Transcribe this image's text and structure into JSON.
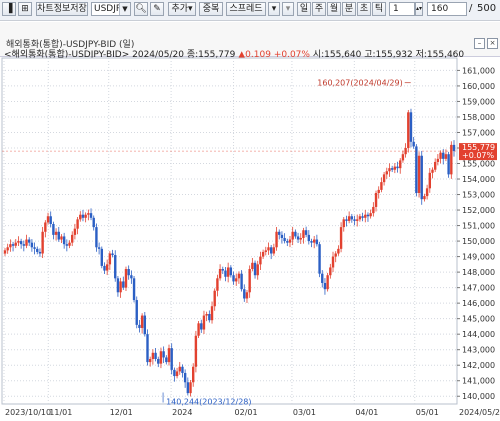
{
  "toolbar": {
    "items": [
      {
        "name": "chart-icon",
        "glyph": "▐"
      },
      {
        "name": "grid-icon",
        "glyph": "⊞"
      }
    ],
    "save_label": "차트정보저장",
    "symbol_value": "USDJPY",
    "add_label": "추가",
    "overlap_label": "중복",
    "spread_label": "스프레드",
    "periods": [
      "일",
      "주",
      "월",
      "분",
      "초",
      "틱"
    ],
    "interval_value": "1",
    "count_value": "160",
    "total_value": "500"
  },
  "header": {
    "window_title": "해외통화(통합)-USDJPY-BID (일)",
    "info_prefix": "<해외통화(통합)-USDJPY-BID> 2024/05/20 종:155,779",
    "info_change": "▲0.109 +0.07%",
    "info_suffix": "시:155,640 고:155,932 저:155,460"
  },
  "chart_data": {
    "type": "candlestick",
    "symbol": "USDJPY-BID",
    "period": "일",
    "date_range": [
      "2023-10-10",
      "2024-05-20"
    ],
    "ylim": [
      139.5,
      161.8
    ],
    "yticks": [
      140,
      141,
      142,
      143,
      144,
      145,
      146,
      147,
      148,
      149,
      150,
      151,
      152,
      153,
      154,
      155,
      156,
      157,
      158,
      159,
      160,
      161
    ],
    "ytick_labels": [
      "140,000",
      "141,000",
      "142,000",
      "143,000",
      "144,000",
      "145,000",
      "146,000",
      "147,000",
      "148,000",
      "149,000",
      "150,000",
      "151,000",
      "152,000",
      "153,000",
      "154,000",
      "155,000",
      "156,000",
      "157,000",
      "158,000",
      "159,000",
      "160,000",
      "161,000"
    ],
    "xtick_labels": [
      "2023/10/10",
      "11/01",
      "12/01",
      "2024",
      "02/01",
      "03/01",
      "04/01",
      "05/01",
      "2024/05/20"
    ],
    "last_price": "155,779",
    "last_change": "+0.07%",
    "annotations": [
      {
        "text": "160,207(2024/04/29)",
        "x": "2024-04-29",
        "y": 160.207
      },
      {
        "text": "140,244(2023/12/28)",
        "x": "2023-12-28",
        "y": 140.244
      }
    ],
    "closes": [
      149.4,
      149.6,
      149.8,
      149.7,
      149.9,
      150.0,
      149.8,
      149.7,
      150.1,
      149.9,
      149.6,
      149.5,
      149.3,
      149.2,
      150.6,
      151.2,
      151.6,
      151.1,
      150.4,
      150.6,
      150.1,
      150.3,
      149.8,
      149.7,
      149.9,
      150.4,
      150.8,
      151.4,
      151.7,
      151.5,
      151.7,
      151.8,
      151.5,
      150.9,
      149.6,
      149.5,
      148.4,
      148.1,
      148.5,
      149.2,
      149.1,
      147.6,
      146.7,
      147.4,
      147.0,
      148.2,
      147.8,
      147.6,
      146.2,
      144.6,
      144.4,
      145.2,
      144.0,
      142.2,
      142.4,
      142.8,
      142.4,
      142.1,
      142.9,
      142.5,
      142.2,
      143.1,
      141.7,
      141.3,
      141.6,
      141.9,
      141.5,
      140.9,
      140.2,
      140.9,
      141.9,
      143.9,
      144.7,
      144.3,
      145.2,
      145.3,
      144.9,
      145.8,
      146.8,
      147.6,
      148.2,
      148.1,
      147.7,
      148.3,
      147.8,
      147.4,
      147.6,
      147.9,
      146.9,
      146.3,
      146.7,
      148.2,
      148.6,
      147.8,
      148.5,
      149.0,
      149.3,
      149.4,
      149.6,
      149.2,
      149.6,
      150.6,
      150.4,
      150.2,
      150.0,
      149.9,
      150.1,
      150.6,
      150.3,
      150.1,
      150.2,
      150.7,
      150.4,
      150.0,
      149.9,
      150.1,
      149.8,
      147.9,
      147.3,
      146.9,
      147.8,
      148.3,
      149.0,
      149.2,
      149.5,
      150.9,
      151.4,
      151.3,
      151.6,
      151.4,
      151.3,
      151.4,
      151.6,
      151.5,
      151.7,
      151.6,
      151.8,
      152.2,
      153.1,
      153.3,
      153.8,
      154.3,
      154.5,
      154.7,
      154.6,
      154.8,
      154.7,
      155.2,
      155.6,
      156.0,
      158.3,
      156.4,
      156.1,
      153.1,
      155.5,
      152.7,
      152.9,
      153.4,
      154.4,
      154.6,
      155.1,
      155.3,
      155.7,
      155.3,
      155.6,
      154.3,
      156.2,
      155.8
    ]
  }
}
